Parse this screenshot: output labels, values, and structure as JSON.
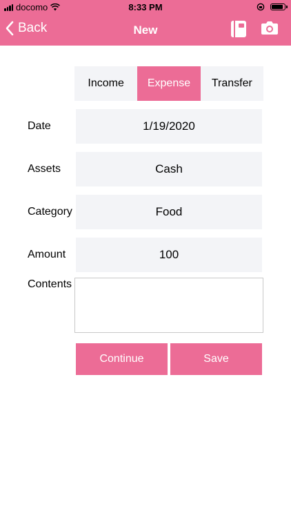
{
  "status_bar": {
    "carrier": "docomo",
    "time": "8:33 PM",
    "battery_level": 0.9
  },
  "nav": {
    "back_label": "Back",
    "title": "New",
    "icons": [
      "chevron-left-icon",
      "notebook-icon",
      "camera-icon"
    ]
  },
  "segment": {
    "options": [
      "Income",
      "Expense",
      "Transfer"
    ],
    "selected": "Expense"
  },
  "form": {
    "date": {
      "label": "Date",
      "value": "1/19/2020"
    },
    "assets": {
      "label": "Assets",
      "value": "Cash"
    },
    "category": {
      "label": "Category",
      "value": "Food"
    },
    "amount": {
      "label": "Amount",
      "value": "100"
    },
    "contents": {
      "label": "Contents",
      "value": ""
    }
  },
  "buttons": {
    "continue": "Continue",
    "save": "Save"
  },
  "colors": {
    "accent": "#ec6c96",
    "field_bg": "#f3f4f7",
    "border": "#c8c8c8"
  }
}
